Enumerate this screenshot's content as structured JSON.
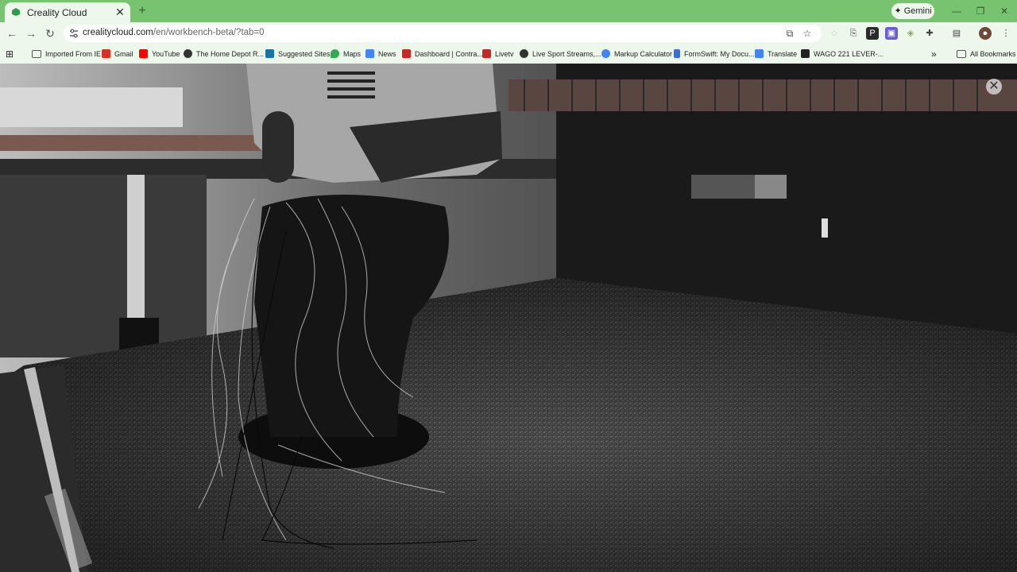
{
  "tab": {
    "title": "Creality Cloud",
    "close": "✕"
  },
  "new_tab": "+",
  "gemini": {
    "label": "Gemini",
    "icon": "sparkle-icon"
  },
  "window_controls": {
    "minimize": "—",
    "restore": "❐",
    "close": "✕"
  },
  "nav": {
    "back": "←",
    "forward": "→",
    "reload": "↻"
  },
  "address": {
    "host": "crealitycloud.com",
    "path": "/en/workbench-beta/?tab=0"
  },
  "bookmarks": {
    "items": [
      {
        "label": "Imported From IE",
        "icon": "folder-icon",
        "color": "#555555"
      },
      {
        "label": "Gmail",
        "icon": "gmail-icon",
        "color": "#d93025"
      },
      {
        "label": "YouTube",
        "icon": "youtube-icon",
        "color": "#ff0000"
      },
      {
        "label": "The Home Depot R...",
        "icon": "globe-icon",
        "color": "#333333"
      },
      {
        "label": "Suggested Sites",
        "icon": "bing-icon",
        "color": "#1a73a8"
      },
      {
        "label": "Maps",
        "icon": "maps-icon",
        "color": "#34a853"
      },
      {
        "label": "News",
        "icon": "news-icon",
        "color": "#4285f4"
      },
      {
        "label": "Dashboard | Contra...",
        "icon": "dashboard-icon",
        "color": "#c62828"
      },
      {
        "label": "Livetv",
        "icon": "livetv-icon",
        "color": "#c62828"
      },
      {
        "label": "Live Sport Streams,...",
        "icon": "globe-icon",
        "color": "#333333"
      },
      {
        "label": "Markup Calculator",
        "icon": "google-icon",
        "color": "#4285f4"
      },
      {
        "label": "FormSwift: My Docu...",
        "icon": "formswift-icon",
        "color": "#3b6fd6"
      },
      {
        "label": "Translate",
        "icon": "translate-icon",
        "color": "#4285f4"
      },
      {
        "label": "WAGO 221 LEVER-...",
        "icon": "amazon-icon",
        "color": "#222222"
      }
    ],
    "more": "»",
    "all_bookmarks": "All Bookmarks"
  },
  "viewer": {
    "close": "✕"
  },
  "colors": {
    "chrome_green": "#78c36f",
    "toolbar": "#eef7ec"
  }
}
